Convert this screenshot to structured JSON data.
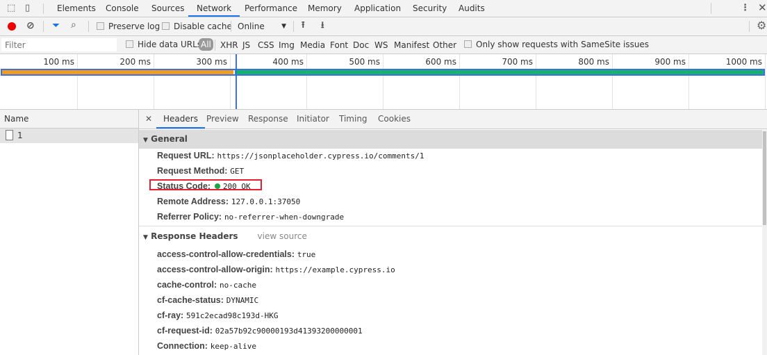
{
  "tabs": {
    "items": [
      "Elements",
      "Console",
      "Sources",
      "Network",
      "Performance",
      "Memory",
      "Application",
      "Security",
      "Audits"
    ],
    "active": "Network"
  },
  "toolbar": {
    "preserve_log": "Preserve log",
    "disable_cache": "Disable cache",
    "throttle": "Online"
  },
  "filterbar": {
    "placeholder": "Filter",
    "hide_data_urls": "Hide data URLs",
    "types": [
      "All",
      "XHR",
      "JS",
      "CSS",
      "Img",
      "Media",
      "Font",
      "Doc",
      "WS",
      "Manifest",
      "Other"
    ],
    "active_type": "All",
    "samesite": "Only show requests with SameSite issues"
  },
  "timeline": {
    "ticks": [
      "100 ms",
      "200 ms",
      "300 ms",
      "400 ms",
      "500 ms",
      "600 ms",
      "700 ms",
      "800 ms",
      "900 ms",
      "1000 ms"
    ],
    "waiting_end_ms": 305,
    "total_ms": 1000,
    "colors": {
      "waiting": "#f29c1f",
      "download": "#17b26a",
      "marker": "#3f6fe4"
    }
  },
  "requests": {
    "header": "Name",
    "items": [
      "1"
    ]
  },
  "details": {
    "tabs": [
      "Headers",
      "Preview",
      "Response",
      "Initiator",
      "Timing",
      "Cookies"
    ],
    "active": "Headers",
    "general": {
      "title": "General",
      "rows": [
        {
          "k": "Request URL:",
          "v": "https://jsonplaceholder.cypress.io/comments/1"
        },
        {
          "k": "Request Method:",
          "v": "GET"
        },
        {
          "k": "Status Code:",
          "v": "200 OK",
          "status_color": "#1ea446",
          "highlighted": true
        },
        {
          "k": "Remote Address:",
          "v": "127.0.0.1:37050"
        },
        {
          "k": "Referrer Policy:",
          "v": "no-referrer-when-downgrade"
        }
      ]
    },
    "response": {
      "title": "Response Headers",
      "view_source": "view source",
      "rows": [
        {
          "k": "access-control-allow-credentials:",
          "v": "true"
        },
        {
          "k": "access-control-allow-origin:",
          "v": "https://example.cypress.io"
        },
        {
          "k": "cache-control:",
          "v": "no-cache"
        },
        {
          "k": "cf-cache-status:",
          "v": "DYNAMIC"
        },
        {
          "k": "cf-ray:",
          "v": "591c2ecad98c193d-HKG"
        },
        {
          "k": "cf-request-id:",
          "v": "02a57b92c90000193d41393200000001"
        },
        {
          "k": "Connection:",
          "v": "keep-alive"
        }
      ]
    }
  }
}
